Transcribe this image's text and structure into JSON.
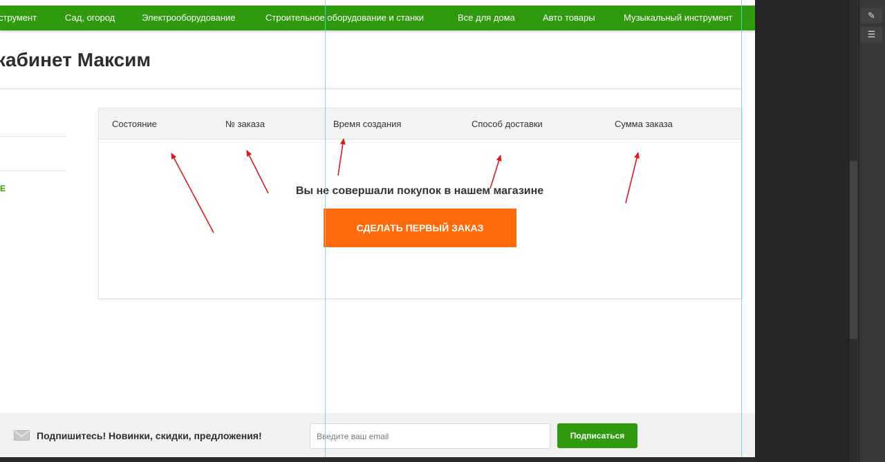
{
  "nav": {
    "items": [
      "струмент",
      "Сад, огород",
      "Электрооборудование",
      "Строительное оборудование и станки",
      "Все для дома",
      "Авто товары",
      "Музыкальный инструмент"
    ]
  },
  "page": {
    "title": "кабинет Максим"
  },
  "sidebar": {
    "fragment": "E"
  },
  "orders": {
    "columns": [
      "Состояние",
      "№ заказа",
      "Время создания",
      "Способ доставки",
      "Сумма заказа"
    ],
    "empty_message": "Вы не совершали покупок в нашем магазине",
    "cta_label": "СДЕЛАТЬ ПЕРВЫЙ ЗАКАЗ"
  },
  "footer": {
    "subscribe_text": "Подпишитесь! Новинки, скидки, предложения!",
    "email_placeholder": "Введите ваш email",
    "subscribe_button": "Подписаться"
  },
  "colors": {
    "brand_green": "#2f9a0d",
    "cta_orange": "#ff6a0a",
    "annotation_arrow": "#d9191c",
    "guide_line": "#5fd6e0"
  },
  "icons": {
    "subscribe": "mail-icon",
    "tool_1": "brush-settings-icon",
    "tool_2": "adjust-icon"
  }
}
